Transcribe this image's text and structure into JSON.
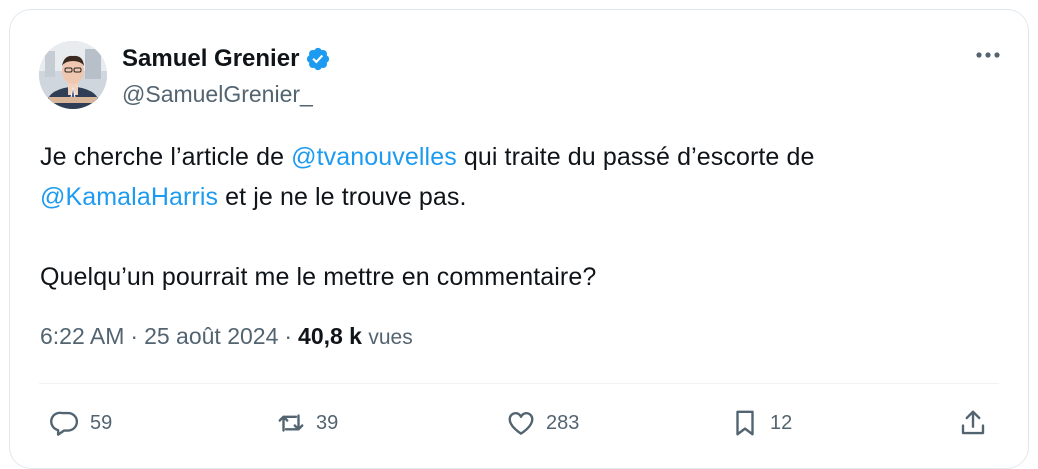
{
  "user": {
    "name": "Samuel Grenier",
    "handle": "@SamuelGrenier_"
  },
  "tweet": {
    "line1_start": "Je cherche l’article de ",
    "mention1": "@tvanouvelles",
    "line1_end": " qui traite du passé d’escorte de",
    "mention2": "@KamalaHarris",
    "line2_end": " et je ne le trouve pas.",
    "line3": "Quelqu’un pourrait me le mettre en commentaire?"
  },
  "meta": {
    "time": "6:22 AM",
    "date": "25 août 2024",
    "views_count": "40,8 k",
    "views_label": "vues"
  },
  "actions": {
    "replies": "59",
    "reposts": "39",
    "likes": "283",
    "bookmarks": "12"
  },
  "icons": {
    "verified": "verified-badge-icon",
    "more": "more-icon",
    "reply": "reply-icon",
    "repost": "repost-icon",
    "like": "heart-icon",
    "bookmark": "bookmark-icon",
    "share": "share-icon"
  },
  "colors": {
    "accent": "#1d9bf0",
    "text": "#0f1419",
    "secondary": "#536471"
  }
}
